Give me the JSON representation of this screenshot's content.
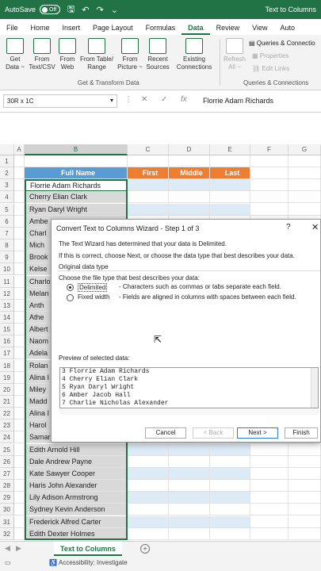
{
  "titlebar": {
    "autosave": "AutoSave",
    "toggle": "Off",
    "doc_title": "Text to Columns"
  },
  "menu": {
    "tabs": [
      "File",
      "Home",
      "Insert",
      "Page Layout",
      "Formulas",
      "Data",
      "Review",
      "View",
      "Auto"
    ],
    "active": "Data"
  },
  "ribbon": {
    "get_data": "Get Data ~",
    "from_text_csv": "From Text/CSV",
    "from_web": "From Web",
    "from_table": "From Table/ Range",
    "from_picture": "From Picture ~",
    "recent_sources": "Recent Sources",
    "existing_connections": "Existing Connections",
    "refresh_all": "Refresh All ~",
    "queries_connections": "Queries & Connectio",
    "properties": "Properties",
    "edit_links": "Edit Links",
    "group_get_transform": "Get & Transform Data",
    "group_queries": "Queries & Connections"
  },
  "formulabar": {
    "name_box": "30R x 1C",
    "fx": "fx",
    "formula": "Florrie Adam Richards"
  },
  "columns": [
    "A",
    "B",
    "C",
    "D",
    "E",
    "F",
    "G"
  ],
  "headers": {
    "full_name": "Full Name",
    "first": "First",
    "middle": "Middle",
    "last": "Last"
  },
  "rows": [
    {
      "n": "1",
      "b": ""
    },
    {
      "n": "2",
      "b": ""
    },
    {
      "n": "3",
      "b": "Florrie Adam Richards"
    },
    {
      "n": "4",
      "b": "Cherry Elian Clark"
    },
    {
      "n": "5",
      "b": "Ryan Daryl Wright"
    },
    {
      "n": "6",
      "b": "Ambe"
    },
    {
      "n": "7",
      "b": "Charl"
    },
    {
      "n": "8",
      "b": "Mich"
    },
    {
      "n": "9",
      "b": "Brook"
    },
    {
      "n": "10",
      "b": "Kelse"
    },
    {
      "n": "11",
      "b": "Charlo"
    },
    {
      "n": "12",
      "b": "Melan"
    },
    {
      "n": "13",
      "b": "Anth"
    },
    {
      "n": "14",
      "b": "Athe"
    },
    {
      "n": "15",
      "b": "Albert"
    },
    {
      "n": "16",
      "b": "Naom"
    },
    {
      "n": "17",
      "b": "Adela"
    },
    {
      "n": "18",
      "b": "Rolan"
    },
    {
      "n": "19",
      "b": "Alina I"
    },
    {
      "n": "20",
      "b": "Miley"
    },
    {
      "n": "21",
      "b": "Madd"
    },
    {
      "n": "22",
      "b": "Alina I"
    },
    {
      "n": "23",
      "b": "Harol"
    },
    {
      "n": "24",
      "b": "Samar"
    },
    {
      "n": "25",
      "b": "Edith Arnold Hill"
    },
    {
      "n": "26",
      "b": "Dale Andrew Payne"
    },
    {
      "n": "27",
      "b": "Kate Sawyer Cooper"
    },
    {
      "n": "28",
      "b": "Haris John Alexander"
    },
    {
      "n": "29",
      "b": "Lily Adison Armstrong"
    },
    {
      "n": "30",
      "b": "Sydney Kevin Anderson"
    },
    {
      "n": "31",
      "b": "Frederick Alfred Carter"
    },
    {
      "n": "32",
      "b": "Edith Dexter Holmes"
    }
  ],
  "sheet": {
    "tab": "Text to Columns",
    "add": "+"
  },
  "status": {
    "accessibility": "Accessibility: Investigate"
  },
  "dialog": {
    "title": "Convert Text to Columns Wizard - Step 1 of 3",
    "help": "?",
    "close": "✕",
    "line1": "The Text Wizard has determined that your data is Delimited.",
    "line2": "If this is correct, choose Next, or choose the data type that best describes your data.",
    "group_label": "Original data type",
    "choose_label": "Choose the file type that best describes your data:",
    "opt_delimited": "Delimited",
    "opt_delimited_desc": "- Characters such as commas or tabs separate each field.",
    "opt_fixed": "Fixed width",
    "opt_fixed_desc": "- Fields are aligned in columns with spaces between each field.",
    "preview_label": "Preview of selected data:",
    "preview_lines": [
      "3 Florrie Adam Richards",
      "4 Cherry Elian Clark",
      "5 Ryan Daryl Wright",
      "6 Amber Jacob Hall",
      "7 Charlie Nicholas Alexander"
    ],
    "cancel": "Cancel",
    "back": "< Back",
    "next": "Next >",
    "finish": "Finish"
  },
  "colors": {
    "excel_green": "#217346",
    "header_blue": "#5b9bd5",
    "header_orange": "#ed7d31",
    "band_blue": "#ddebf7",
    "selection_gray": "#d9d9d9"
  }
}
